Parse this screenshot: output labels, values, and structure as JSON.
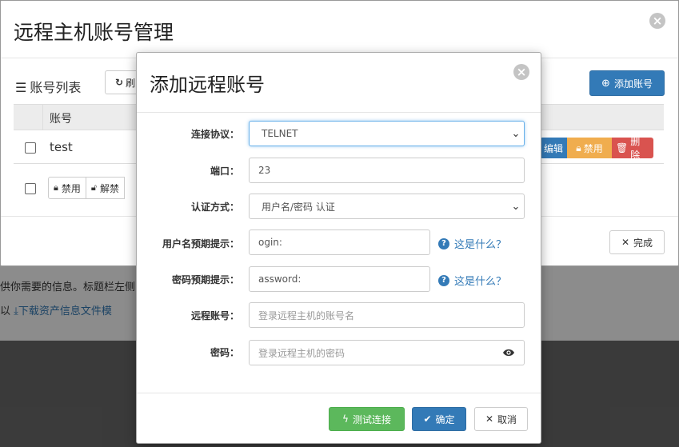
{
  "page": {
    "text_line1": "供你需要的信息。标题栏左侧",
    "text_line2_prefix": "以",
    "download_link": "下载资产信息文件模"
  },
  "outer_modal": {
    "title": "远程主机账号管理",
    "list_title": "账号列表",
    "refresh_label": "刷",
    "add_account_label": "添加账号",
    "table": {
      "header_account": "账号",
      "rows": [
        {
          "account": "test",
          "edit_label": "编辑",
          "disable_label": "禁用",
          "delete_label": "删除"
        }
      ]
    },
    "bulk": {
      "disable_label": "禁用",
      "unlock_label": "解禁"
    },
    "done_label": "完成"
  },
  "inner_modal": {
    "title": "添加远程账号",
    "fields": {
      "protocol": {
        "label": "连接协议：",
        "value": "TELNET"
      },
      "port": {
        "label": "端口：",
        "value": "23"
      },
      "auth": {
        "label": "认证方式：",
        "value": "用户名/密码 认证"
      },
      "user_prompt": {
        "label": "用户名预期提示：",
        "value": "ogin:",
        "help": "这是什么？"
      },
      "pass_prompt": {
        "label": "密码预期提示：",
        "value": "assword:",
        "help": "这是什么？"
      },
      "remote_account": {
        "label": "远程账号：",
        "placeholder": "登录远程主机的账号名"
      },
      "password": {
        "label": "密码：",
        "placeholder": "登录远程主机的密码"
      }
    },
    "buttons": {
      "test": "测试连接",
      "ok": "确定",
      "cancel": "取消"
    }
  },
  "colors": {
    "primary": "#337ab7",
    "success": "#5cb85c",
    "warning": "#f0ad4e",
    "danger": "#d9534f"
  },
  "icons": [
    "list-icon",
    "refresh-icon",
    "plus-circle-icon",
    "lock-icon",
    "trash-icon",
    "edit-icon",
    "close-icon",
    "x-icon",
    "check-icon",
    "bolt-icon",
    "eye-icon",
    "question-icon",
    "download-icon",
    "chevron-down-icon"
  ]
}
